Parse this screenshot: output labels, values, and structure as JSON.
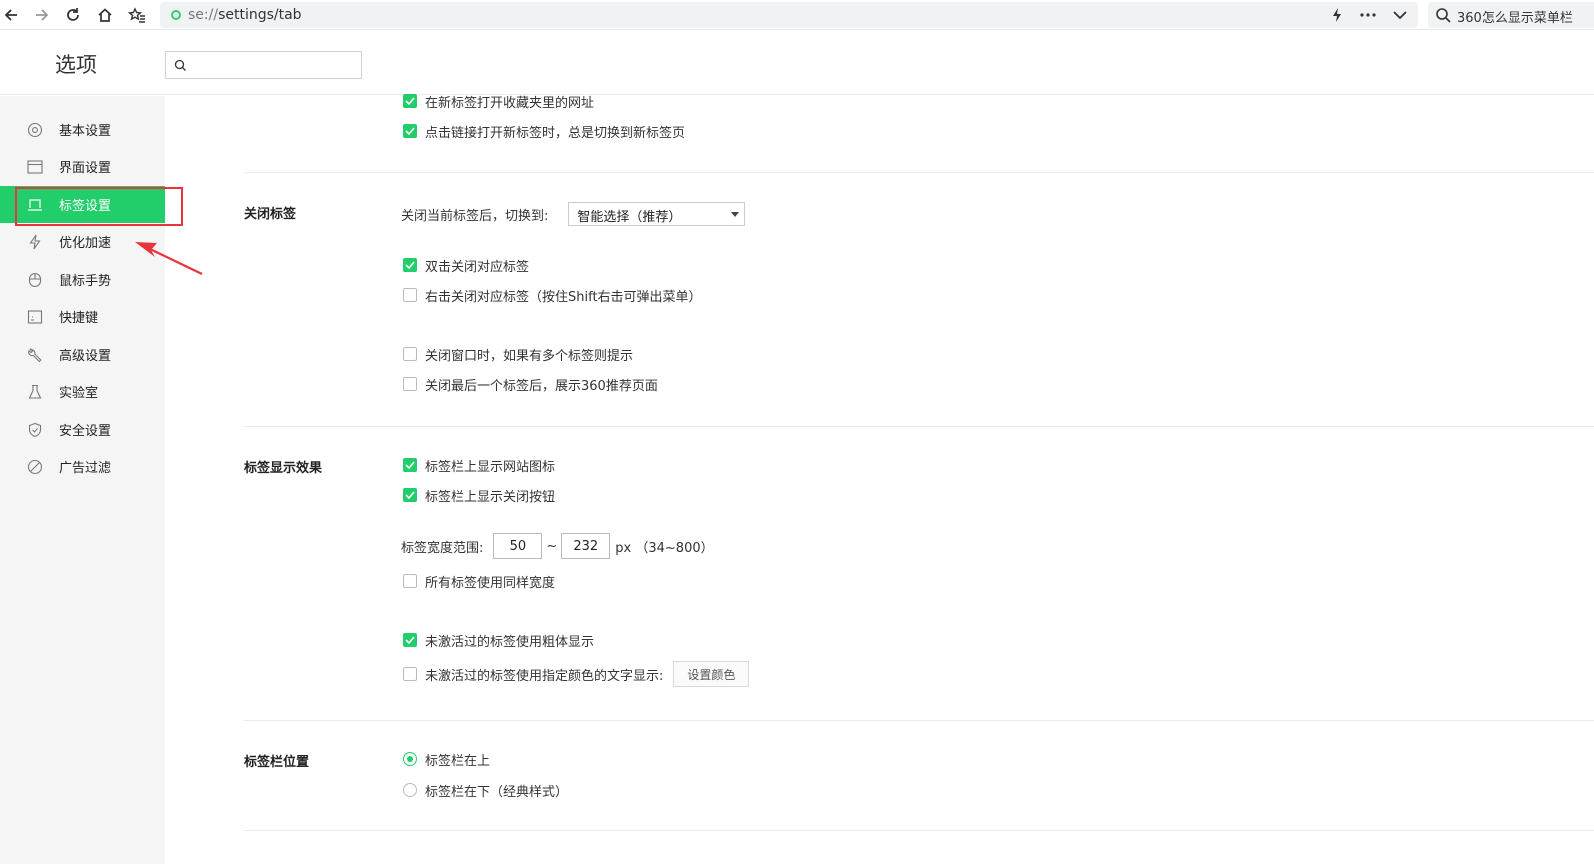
{
  "browser": {
    "url_scheme": "se://",
    "url_path": "settings/tab",
    "search_text": "360怎么显示菜单栏"
  },
  "header": {
    "title": "选项",
    "search_placeholder": ""
  },
  "sidebar": {
    "items": [
      {
        "label": "基本设置",
        "icon": "gear-icon"
      },
      {
        "label": "界面设置",
        "icon": "window-icon"
      },
      {
        "label": "标签设置",
        "icon": "tab-icon",
        "active": true
      },
      {
        "label": "优化加速",
        "icon": "lightning-icon"
      },
      {
        "label": "鼠标手势",
        "icon": "mouse-icon"
      },
      {
        "label": "快捷键",
        "icon": "keyboard-icon"
      },
      {
        "label": "高级设置",
        "icon": "wrench-icon"
      },
      {
        "label": "实验室",
        "icon": "flask-icon"
      },
      {
        "label": "安全设置",
        "icon": "shield-icon"
      },
      {
        "label": "广告过滤",
        "icon": "block-icon"
      }
    ]
  },
  "top_options": [
    {
      "label": "在新标签打开收藏夹里的网址",
      "checked": true
    },
    {
      "label": "点击链接打开新标签时，总是切换到新标签页",
      "checked": true
    }
  ],
  "close_tab": {
    "title": "关闭标签",
    "switch_label": "关闭当前标签后，切换到:",
    "switch_value": "智能选择（推荐）",
    "options": [
      {
        "label": "双击关闭对应标签",
        "checked": true
      },
      {
        "label": "右击关闭对应标签（按住Shift右击可弹出菜单）",
        "checked": false
      },
      {
        "label": "关闭窗口时，如果有多个标签则提示",
        "checked": false
      },
      {
        "label": "关闭最后一个标签后，展示360推荐页面",
        "checked": false
      }
    ]
  },
  "display": {
    "title": "标签显示效果",
    "options": [
      {
        "label": "标签栏上显示网站图标",
        "checked": true
      },
      {
        "label": "标签栏上显示关闭按钮",
        "checked": true
      }
    ],
    "width_label": "标签宽度范围:",
    "width_min": "50",
    "width_sep": "~",
    "width_max": "232",
    "width_unit": "px （34~800）",
    "same_width": {
      "label": "所有标签使用同样宽度",
      "checked": false
    },
    "bold_inactive": {
      "label": "未激活过的标签使用粗体显示",
      "checked": true
    },
    "color_inactive": {
      "label": "未激活过的标签使用指定颜色的文字显示:",
      "checked": false
    },
    "color_button": "设置颜色"
  },
  "position": {
    "title": "标签栏位置",
    "options": [
      {
        "label": "标签栏在上",
        "selected": true
      },
      {
        "label": "标签栏在下（经典样式）",
        "selected": false
      }
    ]
  },
  "colors": {
    "accent": "#21ce6b",
    "annotation": "#e8343a"
  }
}
